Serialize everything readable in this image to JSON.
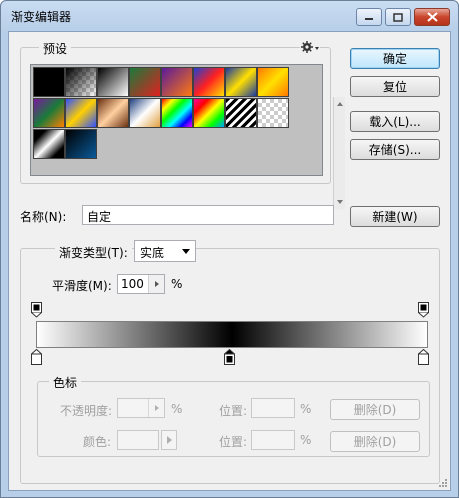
{
  "window": {
    "title": "渐变编辑器"
  },
  "presets": {
    "legend": "预设",
    "swatches_row1": [
      "linear-gradient(#000,#000)",
      "linear-gradient(135deg,#000 0%,rgba(0,0,0,0) 100%),repeating-conic-gradient(#ccc 0% 25%,#fff 0% 50%) 0 0/8px 8px",
      "linear-gradient(135deg,#000,#fff)",
      "linear-gradient(135deg,#1a7a3a,#e02020)",
      "linear-gradient(135deg,#5a1a9a,#ff7a10)",
      "linear-gradient(135deg,#2040d0,#ff2020,#ffe000)",
      "linear-gradient(135deg,#1a3aa0,#ffe000,#1a3aa0)",
      "linear-gradient(135deg,#ff7a00,#ffe000,#ff7a00)"
    ],
    "swatches_row2": [
      "linear-gradient(135deg,#7a1aa0,#1a7a3a,#ff8000)",
      "linear-gradient(135deg,#3050ff,#ffd000,#3050ff)",
      "linear-gradient(135deg,#6a3010,#ffd0a0,#6a3010)",
      "linear-gradient(135deg,#204080,#fff 50%,#e0a040)",
      "linear-gradient(135deg,#ff0000,#ffff00,#00ff00,#00ffff,#0000ff,#ff00ff)",
      "linear-gradient(135deg,#ff00a0,#ff0000,#ffff00,#00ff00,#00a0ff)",
      "repeating-linear-gradient(135deg,#000 0 3px,#fff 3px 6px)",
      "repeating-conic-gradient(#ccc 0% 25%,#fff 0% 50%) 0 0/8px 8px"
    ],
    "swatches_row3": [
      "linear-gradient(135deg,#000 20%,#fff 50%,#000 80%)",
      "linear-gradient(135deg,#000,#0a5a9a)"
    ]
  },
  "buttons": {
    "ok": "确定",
    "reset": "复位",
    "load": "载入(L)...",
    "save": "存储(S)...",
    "new": "新建(W)"
  },
  "name": {
    "label": "名称(N):",
    "value": "自定"
  },
  "gradient": {
    "type_label": "渐变类型(T):",
    "type_value": "实底",
    "smooth_label": "平滑度(M):",
    "smooth_value": "100",
    "smooth_unit": "%"
  },
  "stops": {
    "legend": "色标",
    "opacity_label": "不透明度:",
    "opacity_unit": "%",
    "location_label": "位置:",
    "location_unit": "%",
    "delete": "删除(D)",
    "color_label": "颜色:"
  }
}
